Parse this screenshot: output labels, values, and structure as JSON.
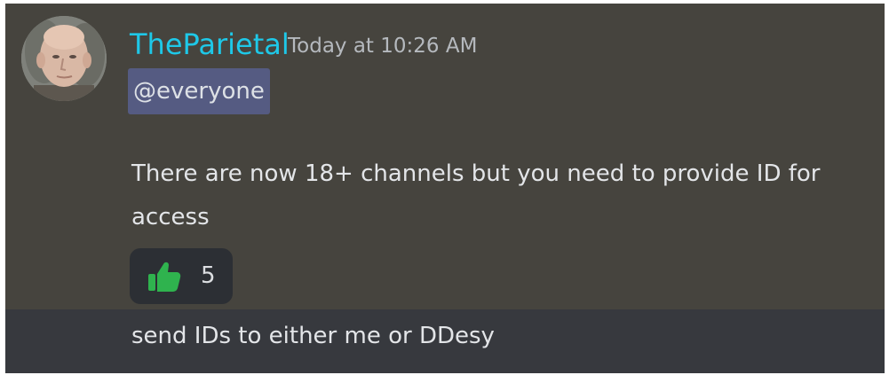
{
  "message": {
    "author": "TheParietal",
    "timestamp": "Today at 10:26 AM",
    "mention": "@everyone",
    "body": "There are now 18+ channels but you need to provide ID for access",
    "reaction": {
      "icon": "thumbs-up-icon",
      "count": "5",
      "color": "#2fb34e"
    }
  },
  "followup": {
    "body": "send IDs to either me or DDesy"
  },
  "colors": {
    "username": "#1ec8e8",
    "highlight_bg": "#46443e",
    "chat_bg": "#37393e",
    "mention_bg": "#555b82"
  }
}
